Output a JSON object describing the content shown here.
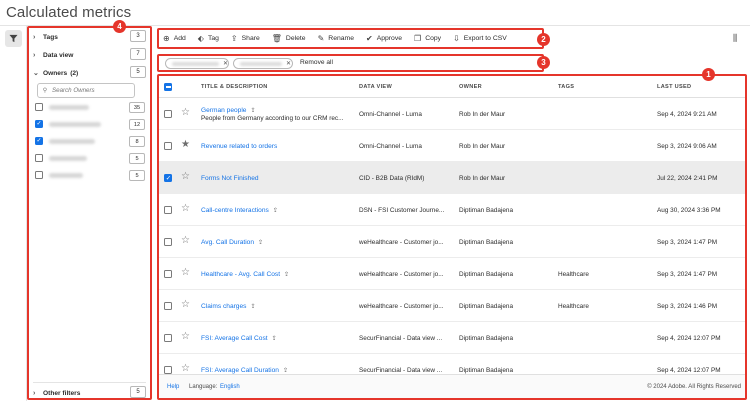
{
  "page_title": "Calculated metrics",
  "filters": {
    "tags_label": "Tags",
    "tags_count": "3",
    "dataview_label": "Data view",
    "dataview_count": "7",
    "owners_label": "Owners",
    "owners_selected": "(2)",
    "owners_count": "5",
    "search_placeholder": "Search Owners",
    "owners": [
      {
        "count": "35",
        "checked": false
      },
      {
        "count": "12",
        "checked": true
      },
      {
        "count": "8",
        "checked": true
      },
      {
        "count": "5",
        "checked": false
      },
      {
        "count": "5",
        "checked": false
      }
    ],
    "other_label": "Other filters",
    "other_count": "5"
  },
  "toolbar": {
    "add": "Add",
    "tag": "Tag",
    "share": "Share",
    "delete": "Delete",
    "rename": "Rename",
    "approve": "Approve",
    "copy": "Copy",
    "export": "Export to CSV"
  },
  "chips": {
    "remove_all": "Remove all"
  },
  "table": {
    "columns": [
      "TITLE & DESCRIPTION",
      "DATA VIEW",
      "OWNER",
      "TAGS",
      "LAST USED"
    ],
    "rows": [
      {
        "title": "German people",
        "desc": "People from Germany according to our CRM rec...",
        "dataview": "Omni-Channel - Luma",
        "owner": "Rob In der Maur",
        "tags": "",
        "last_used": "Sep 4, 2024 9:21 AM",
        "shared": true,
        "starred": false,
        "checked": false
      },
      {
        "title": "Revenue related to orders",
        "desc": "",
        "dataview": "Omni-Channel - Luma",
        "owner": "Rob In der Maur",
        "tags": "",
        "last_used": "Sep 3, 2024 9:06 AM",
        "shared": false,
        "starred": true,
        "checked": false
      },
      {
        "title": "Forms Not Finished",
        "desc": "",
        "dataview": "CID - B2B Data (RIdM)",
        "owner": "Rob In der Maur",
        "tags": "",
        "last_used": "Jul 22, 2024 2:41 PM",
        "shared": false,
        "starred": false,
        "checked": true
      },
      {
        "title": "Call-centre Interactions",
        "desc": "",
        "dataview": "DSN - FSI Customer Journe...",
        "owner": "Diptiman Badajena",
        "tags": "",
        "last_used": "Aug 30, 2024 3:36 PM",
        "shared": true,
        "starred": false,
        "checked": false
      },
      {
        "title": "Avg. Call Duration",
        "desc": "",
        "dataview": "weHealthcare - Customer jo...",
        "owner": "Diptiman Badajena",
        "tags": "",
        "last_used": "Sep 3, 2024 1:47 PM",
        "shared": true,
        "starred": false,
        "checked": false
      },
      {
        "title": "Healthcare - Avg. Call Cost",
        "desc": "",
        "dataview": "weHealthcare - Customer jo...",
        "owner": "Diptiman Badajena",
        "tags": "Healthcare",
        "last_used": "Sep 3, 2024 1:47 PM",
        "shared": true,
        "starred": false,
        "checked": false
      },
      {
        "title": "Claims charges",
        "desc": "",
        "dataview": "weHealthcare - Customer jo...",
        "owner": "Diptiman Badajena",
        "tags": "Healthcare",
        "last_used": "Sep 3, 2024 1:46 PM",
        "shared": true,
        "starred": false,
        "checked": false
      },
      {
        "title": "FSI: Average Call Cost",
        "desc": "",
        "dataview": "SecurFinancial - Data view ...",
        "owner": "Diptiman Badajena",
        "tags": "",
        "last_used": "Sep 4, 2024 12:07 PM",
        "shared": true,
        "starred": false,
        "checked": false
      },
      {
        "title": "FSI: Average Call Duration",
        "desc": "",
        "dataview": "SecurFinancial - Data view ...",
        "owner": "Diptiman Badajena",
        "tags": "",
        "last_used": "Sep 4, 2024 12:07 PM",
        "shared": true,
        "starred": false,
        "checked": false
      }
    ]
  },
  "footer": {
    "help": "Help",
    "language_label": "Language:",
    "language": "English",
    "copyright": "© 2024 Adobe. All Rights Reserved"
  },
  "callouts": {
    "one": "1",
    "two": "2",
    "three": "3",
    "four": "4"
  },
  "colors": {
    "accent": "#1473e6",
    "callout": "#e5352b"
  }
}
